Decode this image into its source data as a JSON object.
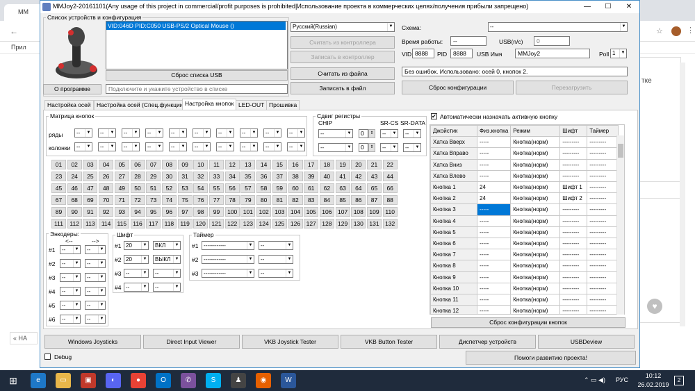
{
  "browser": {
    "tab_label": "MM",
    "bookmarks_label": "Прил",
    "side_text": "тке",
    "bottom_left": "«",
    "bottom_label": "НА"
  },
  "window": {
    "title": "MMJoy2-20161101(Any usage of this project in commercial/profit purposes is prohibited|Использование проекта в коммерческих целях/получения прибыли запрещено)",
    "minimize": "—",
    "maximize": "☐",
    "close": "✕"
  },
  "devices": {
    "group_label": "Список устройств и конфигурация",
    "items": [
      "VID:046D PID:C050 USB-PS/2 Optical Mouse ()"
    ],
    "reset_usb": "Сброс списка USB",
    "about": "О программе",
    "hint": "Подключите и укажите устройство в списке",
    "language": "Русский(Russian)",
    "read_controller": "Считать из контроллера",
    "write_controller": "Записать в контроллер",
    "read_file": "Считать из файла",
    "write_file": "Записать в файл"
  },
  "config": {
    "scheme_label": "Схема:",
    "scheme_value": "--",
    "uptime_label": "Время работы:",
    "uptime_value": "--",
    "usb_nc_label": "USB(n/c)",
    "usb_nc_value": "0",
    "vid_label": "VID",
    "vid_value": "8888",
    "pid_label": "PID",
    "pid_value": "8888",
    "usb_name_label": "USB Имя",
    "usb_name_value": "MMJoy2",
    "poll_label": "Poll",
    "poll_value": "1",
    "status": "Без ошибок. Использовано: осей 0, кнопок 2.",
    "reset_config": "Сброс конфигурации",
    "reboot": "Перезагрузить"
  },
  "tabs": [
    "Настройка осей",
    "Настройка осей (Спец.функции)",
    "Настройка кнопок",
    "LED-OUT",
    "Прошивка"
  ],
  "matrix": {
    "label": "Матрица кнопок",
    "rows_label": "ряды",
    "cols_label": "колонки",
    "dash": "--"
  },
  "shift_reg": {
    "label": "Сдвиг регистры",
    "chip": "CHIP",
    "srcs": "SR-CS",
    "srdata": "SR-DATA",
    "count": "0"
  },
  "encoders": {
    "label": "Энкодеры:",
    "left_arrow": "<--",
    "right_arrow": "-->",
    "rows": [
      "#1",
      "#2",
      "#3",
      "#4",
      "#5",
      "#6"
    ]
  },
  "shift": {
    "label": "Шифт",
    "rows": [
      {
        "n": "#1",
        "v": "20",
        "s": "ВКЛ"
      },
      {
        "n": "#2",
        "v": "20",
        "s": "ВЫКЛ"
      },
      {
        "n": "#3",
        "v": "--",
        "s": "--"
      },
      {
        "n": "#4",
        "v": "--",
        "s": "--"
      }
    ]
  },
  "timer": {
    "label": "Таймер",
    "rows": [
      {
        "n": "#1",
        "v": "------------",
        "s": "--"
      },
      {
        "n": "#2",
        "v": "------------",
        "s": "--"
      },
      {
        "n": "#3",
        "v": "------------",
        "s": "--"
      }
    ]
  },
  "auto_assign": {
    "checked": true,
    "label": "Автоматически назначать активную кнопку"
  },
  "joy_table": {
    "headers": [
      "Джойстик",
      "Физ.кнопка",
      "Режим",
      "Шифт",
      "Таймер"
    ],
    "rows": [
      [
        "Хатка Вверх",
        "-----",
        "Кнопка(норм)",
        "---------",
        "---------"
      ],
      [
        "Хатка Вправо",
        "-----",
        "Кнопка(норм)",
        "---------",
        "---------"
      ],
      [
        "Хатка Вниз",
        "-----",
        "Кнопка(норм)",
        "---------",
        "---------"
      ],
      [
        "Хатка Влево",
        "-----",
        "Кнопка(норм)",
        "---------",
        "---------"
      ],
      [
        "Кнопка 1",
        "24",
        "Кнопка(норм)",
        "Шифт 1",
        "---------"
      ],
      [
        "Кнопка 2",
        "24",
        "Кнопка(норм)",
        "Шифт 2",
        "---------"
      ],
      [
        "Кнопка 3",
        "-----",
        "Кнопка(норм)",
        "---------",
        "---------"
      ],
      [
        "Кнопка 4",
        "-----",
        "Кнопка(норм)",
        "---------",
        "---------"
      ],
      [
        "Кнопка 5",
        "-----",
        "Кнопка(норм)",
        "---------",
        "---------"
      ],
      [
        "Кнопка 6",
        "-----",
        "Кнопка(норм)",
        "---------",
        "---------"
      ],
      [
        "Кнопка 7",
        "-----",
        "Кнопка(норм)",
        "---------",
        "---------"
      ],
      [
        "Кнопка 8",
        "-----",
        "Кнопка(норм)",
        "---------",
        "---------"
      ],
      [
        "Кнопка 9",
        "-----",
        "Кнопка(норм)",
        "---------",
        "---------"
      ],
      [
        "Кнопка 10",
        "-----",
        "Кнопка(норм)",
        "---------",
        "---------"
      ],
      [
        "Кнопка 11",
        "-----",
        "Кнопка(норм)",
        "---------",
        "---------"
      ],
      [
        "Кнопка 12",
        "-----",
        "Кнопка(норм)",
        "---------",
        "---------"
      ]
    ],
    "selected_row": 6,
    "reset_buttons": "Сброс конфигурации кнопок"
  },
  "bottom_buttons": [
    "Windows Joysticks",
    "Direct Input Viewer",
    "VKB Joystick Tester",
    "VKB Button Tester",
    "Диспетчер устройств",
    "USBDeview"
  ],
  "debug_label": "Debug",
  "help_button": "Помоги развитию проекта!",
  "taskbar": {
    "lang": "РУС",
    "time": "10:12",
    "date": "26.02.2019",
    "notif": "2"
  }
}
